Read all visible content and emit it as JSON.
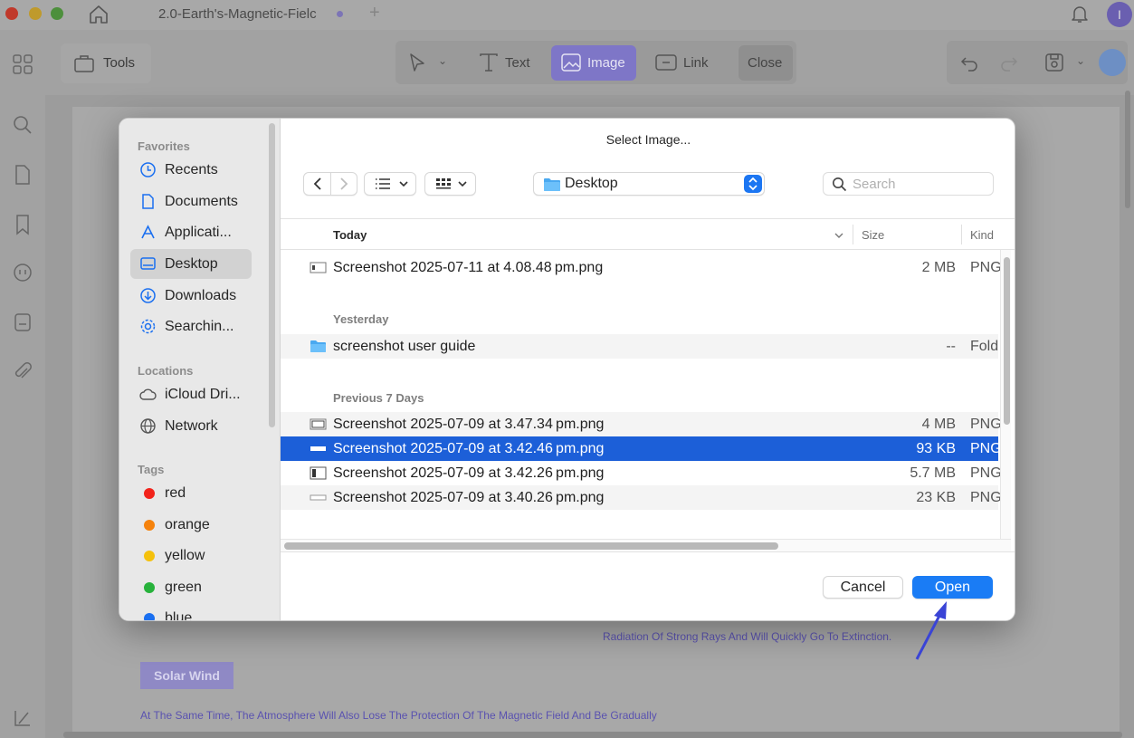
{
  "app": {
    "doc_tab_title": "2.0-Earth's-Magnetic-Fielc",
    "avatar_initial": "I",
    "toolbar": {
      "tools_label": "Tools",
      "text_label": "Text",
      "image_label": "Image",
      "link_label": "Link",
      "close_label": "Close"
    },
    "document": {
      "text_line_1": "Radiation Of Strong Rays And Will Quickly Go To Extinction.",
      "badge": "Solar Wind",
      "text_line_2": "At The Same Time, The Atmosphere Will Also Lose The Protection Of The Magnetic Field And Be Gradually"
    },
    "colors": {
      "accent": "#7e76c7",
      "selection": "#1c5fd8",
      "open_button": "#1a7cf5"
    }
  },
  "dialog": {
    "title": "Select Image...",
    "location": "Desktop",
    "search_placeholder": "Search",
    "sidebar": {
      "favorites_title": "Favorites",
      "favorites": [
        {
          "label": "Recents",
          "icon": "clock-icon"
        },
        {
          "label": "Documents",
          "icon": "document-icon"
        },
        {
          "label": "Applicati...",
          "icon": "applications-icon"
        },
        {
          "label": "Desktop",
          "icon": "desktop-icon",
          "active": true
        },
        {
          "label": "Downloads",
          "icon": "download-icon"
        },
        {
          "label": "Searchin...",
          "icon": "gear-icon"
        }
      ],
      "locations_title": "Locations",
      "locations": [
        {
          "label": "iCloud Dri...",
          "icon": "cloud-icon"
        },
        {
          "label": "Network",
          "icon": "globe-icon"
        }
      ],
      "tags_title": "Tags",
      "tags": [
        {
          "label": "red",
          "color": "#f2231b"
        },
        {
          "label": "orange",
          "color": "#f5820c"
        },
        {
          "label": "yellow",
          "color": "#f5c10c"
        },
        {
          "label": "green",
          "color": "#27b23b"
        },
        {
          "label": "blue",
          "color": "#1a6ff0"
        }
      ]
    },
    "columns": {
      "name": "Today",
      "size": "Size",
      "kind": "Kind"
    },
    "groups": [
      {
        "title": "Today",
        "rows": [
          {
            "name": "Screenshot 2025-07-11 at 4.08.48 pm.png",
            "size": "2 MB",
            "kind": "PNG"
          }
        ]
      },
      {
        "title": "Yesterday",
        "rows": [
          {
            "name": "screenshot user guide",
            "size": "--",
            "kind": "Fold",
            "icon": "folder-icon"
          }
        ]
      },
      {
        "title": "Previous 7 Days",
        "rows": [
          {
            "name": "Screenshot 2025-07-09 at 3.47.34 pm.png",
            "size": "4 MB",
            "kind": "PNG"
          },
          {
            "name": "Screenshot 2025-07-09 at 3.42.46 pm.png",
            "size": "93 KB",
            "kind": "PNG",
            "selected": true
          },
          {
            "name": "Screenshot 2025-07-09 at 3.42.26 pm.png",
            "size": "5.7 MB",
            "kind": "PNG"
          },
          {
            "name": "Screenshot 2025-07-09 at 3.40.26 pm.png",
            "size": "23 KB",
            "kind": "PNG"
          }
        ]
      }
    ],
    "cancel_label": "Cancel",
    "open_label": "Open"
  }
}
